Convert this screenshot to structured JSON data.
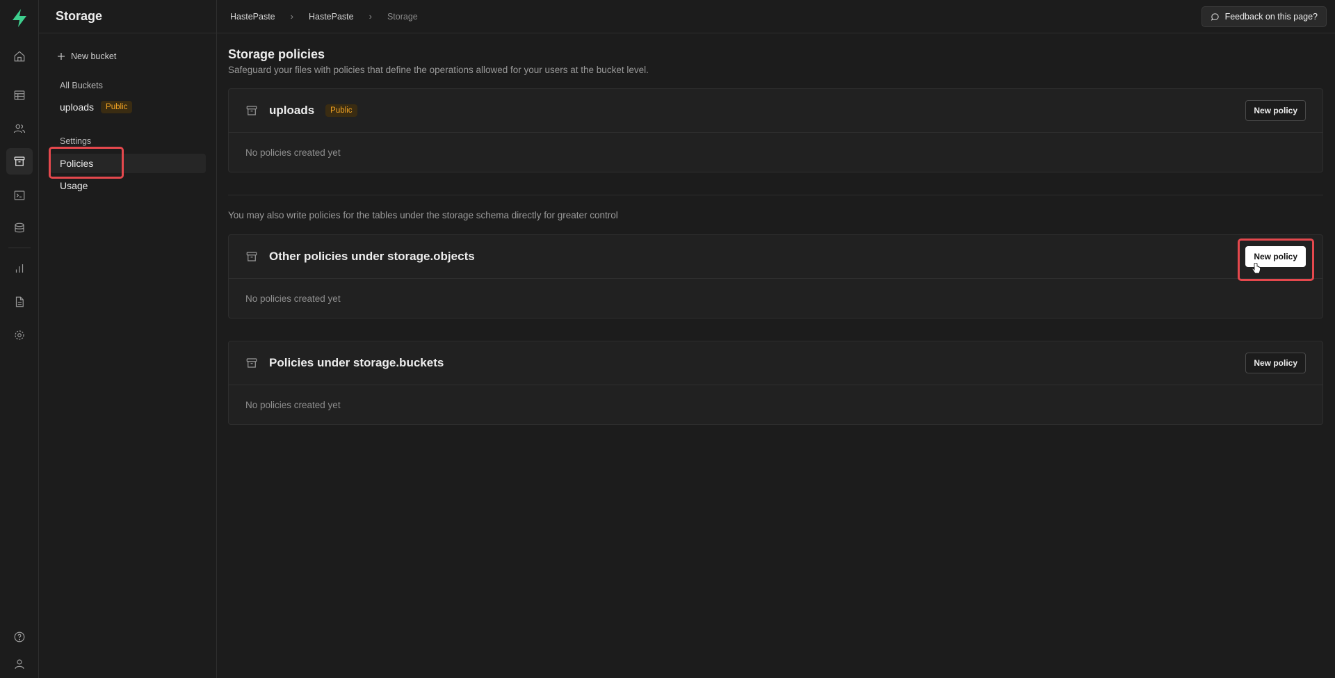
{
  "app": {
    "section_title": "Storage"
  },
  "breadcrumb": [
    "HastePaste",
    "HastePaste",
    "Storage"
  ],
  "header": {
    "feedback_label": "Feedback on this page?"
  },
  "sidebar": {
    "new_bucket_label": "New bucket",
    "all_buckets_label": "All Buckets",
    "buckets": [
      {
        "name": "uploads",
        "badge": "Public"
      }
    ],
    "settings_label": "Settings",
    "nav": [
      {
        "label": "Policies",
        "active": true
      },
      {
        "label": "Usage",
        "active": false
      }
    ]
  },
  "main": {
    "title": "Storage policies",
    "subtitle": "Safeguard your files with policies that define the operations allowed for your users at the bucket level.",
    "note": "You may also write policies for the tables under the storage schema directly for greater control",
    "cards": [
      {
        "title": "uploads",
        "badge": "Public",
        "empty_text": "No policies created yet",
        "button_label": "New policy"
      },
      {
        "title": "Other policies under storage.objects",
        "empty_text": "No policies created yet",
        "button_label": "New policy"
      },
      {
        "title": "Policies under storage.buckets",
        "empty_text": "No policies created yet",
        "button_label": "New policy"
      }
    ]
  },
  "rail_icons": [
    "home-icon",
    "table-editor-icon",
    "users-icon",
    "storage-icon",
    "sql-editor-icon",
    "database-icon",
    "reports-icon",
    "docs-icon",
    "settings-icon",
    "help-icon",
    "account-icon"
  ],
  "colors": {
    "accent": "#3ecf8e",
    "badge_text": "#f5a524",
    "highlight": "#e5484d",
    "background": "#1c1c1c"
  }
}
